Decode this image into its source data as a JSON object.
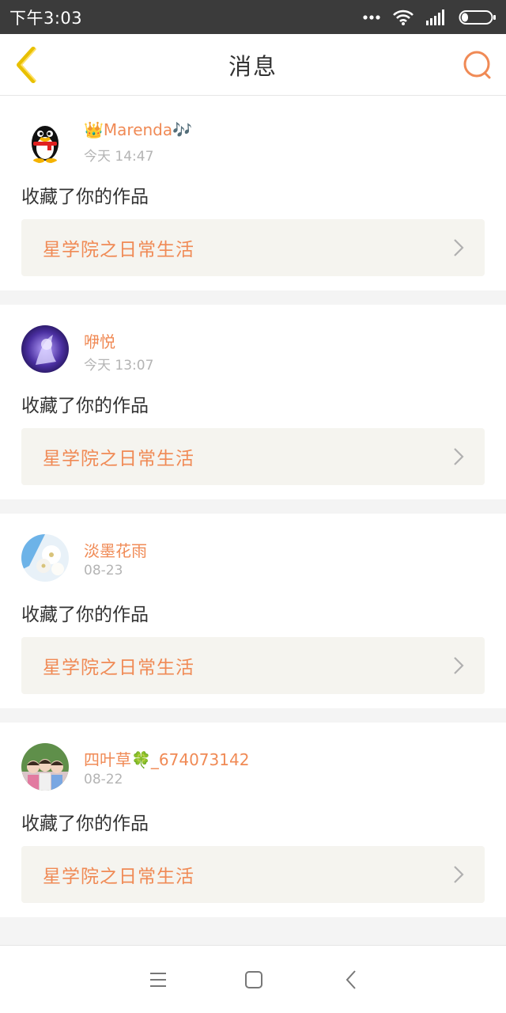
{
  "status_bar": {
    "time": "下午3:03",
    "icons": [
      "more-dots-icon",
      "wifi-icon",
      "signal-icon",
      "battery-icon"
    ]
  },
  "header": {
    "title": "消息",
    "back_icon": "chevron-left-icon",
    "search_icon": "search-icon"
  },
  "colors": {
    "accent": "#f08a55",
    "back_icon": "#e8c000",
    "card_link_bg": "#f5f4ef",
    "status_bar_bg": "#3b3b3b"
  },
  "messages": [
    {
      "user": "👑Marenda🎶",
      "time": "今天 14:47",
      "action": "收藏了你的作品",
      "work": "星学院之日常生活",
      "avatar": "penguin-avatar"
    },
    {
      "user": "咿悦",
      "time": "今天 13:07",
      "action": "收藏了你的作品",
      "work": "星学院之日常生活",
      "avatar": "anime-girl-avatar"
    },
    {
      "user": "淡墨花雨",
      "time": "08-23",
      "action": "收藏了你的作品",
      "work": "星学院之日常生活",
      "avatar": "flower-avatar"
    },
    {
      "user": "四叶草🍀_674073142",
      "time": "08-22",
      "action": "收藏了你的作品",
      "work": "星学院之日常生活",
      "avatar": "kids-photo-avatar"
    }
  ],
  "nav": {
    "icons": [
      "menu-icon",
      "home-icon",
      "back-icon"
    ]
  }
}
